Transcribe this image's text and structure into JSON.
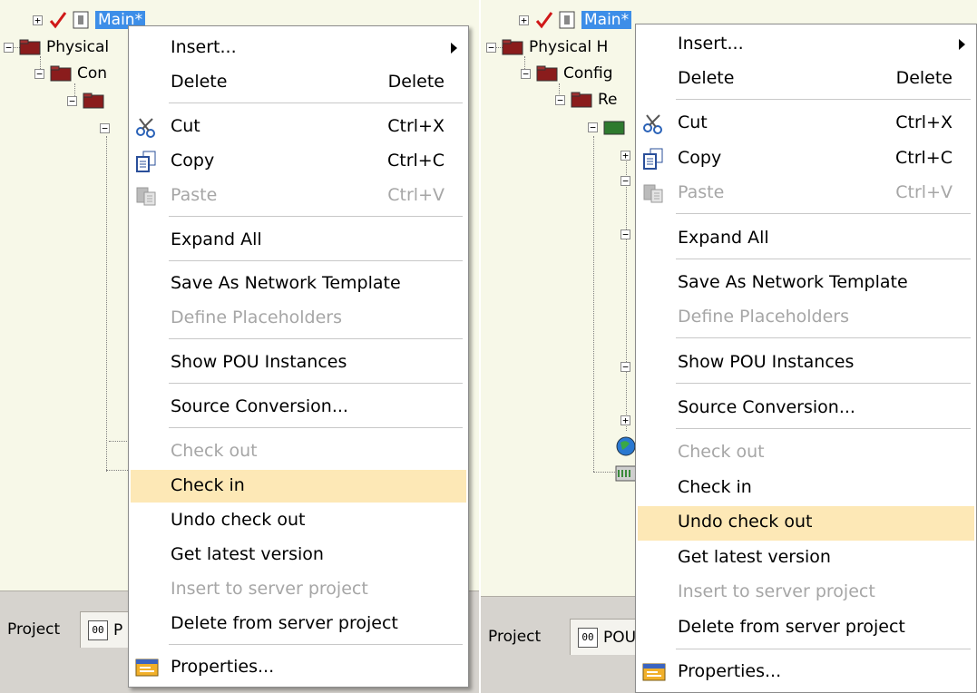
{
  "left": {
    "tree": {
      "top_label": "Main*",
      "physical_label": "Physical",
      "config_label": "Con"
    },
    "tabs": {
      "project": "Project",
      "pou": "P"
    },
    "menu": {
      "insert": "Insert...",
      "delete": "Delete",
      "delete_sc": "Delete",
      "cut": "Cut",
      "cut_sc": "Ctrl+X",
      "copy": "Copy",
      "copy_sc": "Ctrl+C",
      "paste": "Paste",
      "paste_sc": "Ctrl+V",
      "expand_all": "Expand All",
      "save_template": "Save As Network Template",
      "define_placeholders": "Define Placeholders",
      "show_pou": "Show POU Instances",
      "source_conversion": "Source Conversion...",
      "check_out": "Check out",
      "check_in": "Check in",
      "undo_check_out": "Undo check out",
      "get_latest": "Get latest version",
      "insert_server": "Insert to server project",
      "delete_server": "Delete from server project",
      "properties": "Properties..."
    }
  },
  "right": {
    "tree": {
      "top_label": "Main*",
      "physical_label": "Physical H",
      "config_label": "Config",
      "re_label": "Re"
    },
    "tabs": {
      "project": "Project",
      "pou": "POU"
    },
    "menu": {
      "insert": "Insert...",
      "delete": "Delete",
      "delete_sc": "Delete",
      "cut": "Cut",
      "cut_sc": "Ctrl+X",
      "copy": "Copy",
      "copy_sc": "Ctrl+C",
      "paste": "Paste",
      "paste_sc": "Ctrl+V",
      "expand_all": "Expand All",
      "save_template": "Save As Network Template",
      "define_placeholders": "Define Placeholders",
      "show_pou": "Show POU Instances",
      "source_conversion": "Source Conversion...",
      "check_out": "Check out",
      "check_in": "Check in",
      "undo_check_out": "Undo check out",
      "get_latest": "Get latest version",
      "insert_server": "Insert to server project",
      "delete_server": "Delete from server project",
      "properties": "Properties..."
    }
  },
  "colors": {
    "highlight": "#fde8b6",
    "selection": "#3d8ee8",
    "disabled_text": "#a6a6a6",
    "tree_background": "#f7f8e8"
  },
  "icons": [
    "folder-icon",
    "checkmark-icon",
    "scissors-icon",
    "copy-icon",
    "paste-icon",
    "properties-icon",
    "submenu-arrow-icon",
    "pou-tab-icon"
  ]
}
